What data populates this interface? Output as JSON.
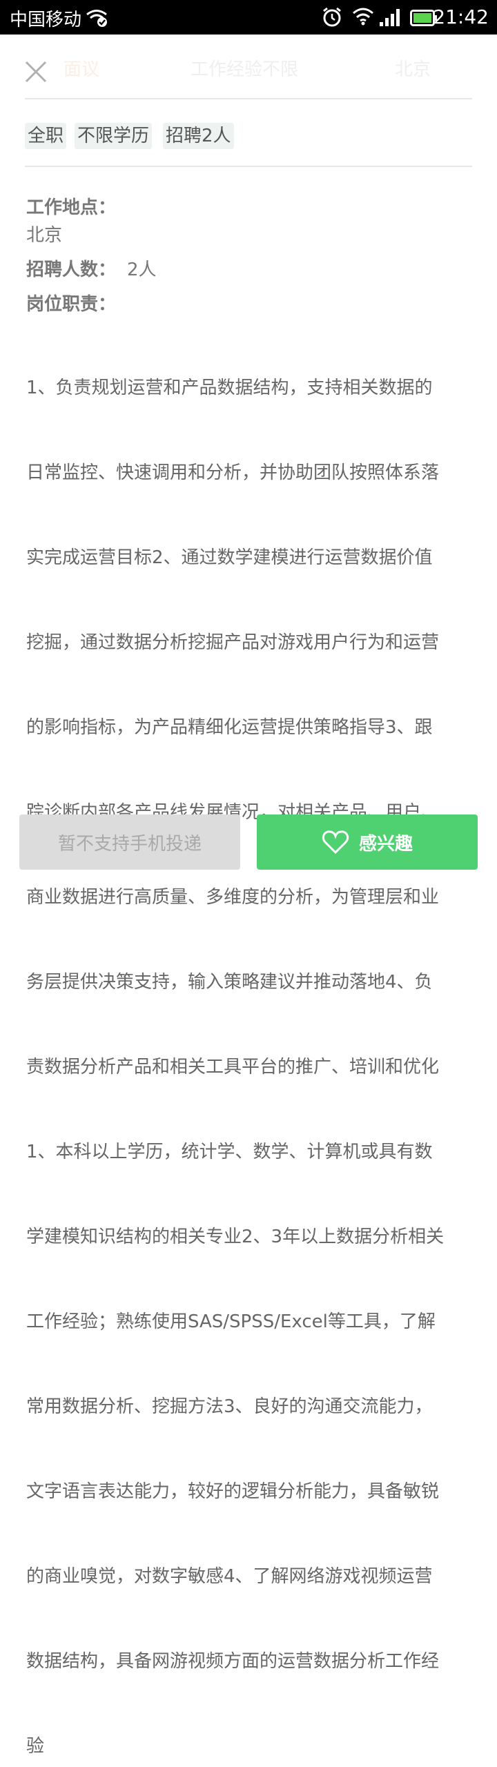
{
  "status_bar": {
    "carrier": "中国移动",
    "time": "21:42",
    "icons": [
      "wifi-check-icon",
      "alarm-icon",
      "wifi-icon",
      "signal-icon",
      "battery-icon"
    ]
  },
  "header": {
    "salary": "面议",
    "experience": "工作经验不限",
    "city": "北京"
  },
  "tags": [
    "全职",
    "不限学历",
    "招聘2人"
  ],
  "details": {
    "location_label": "工作地点：",
    "location_value": "北京",
    "headcount_label": "招聘人数：",
    "headcount_value": "2人",
    "duties_label": "岗位职责：",
    "duties_lines": [
      "1、负责规划运营和产品数据结构，支持相关数据的",
      "日常监控、快速调用和分析，并协助团队按照体系落",
      "实完成运营目标2、通过数学建模进行运营数据价值",
      "挖掘，通过数据分析挖掘产品对游戏用户行为和运营",
      "的影响指标，为产品精细化运营提供策略指导3、跟",
      "踪诊断内部各产品线发展情况，对相关产品、用户、",
      "商业数据进行高质量、多维度的分析，为管理层和业",
      "务层提供决策支持，输入策略建议并推动落地4、负",
      "责数据分析产品和相关工具平台的推广、培训和优化",
      "1、本科以上学历，统计学、数学、计算机或具有数",
      "学建模知识结构的相关专业2、3年以上数据分析相关",
      "工作经验；熟练使用SAS/SPSS/Excel等工具，了解",
      "常用数据分析、挖掘方法3、良好的沟通交流能力，",
      "文字语言表达能力，较好的逻辑分析能力，具备敏锐",
      "的商业嗅觉，对数字敏感4、了解网络游戏视频运营",
      "数据结构，具备网游视频方面的运营数据分析工作经",
      "验"
    ]
  },
  "actions": {
    "mobile_submit_label": "暂不支持手机投递",
    "interest_label": "感兴趣"
  },
  "colors": {
    "accent_green": "#4fd071",
    "disabled_gray": "#dcdcdc",
    "tag_bg": "#eef3f1"
  }
}
